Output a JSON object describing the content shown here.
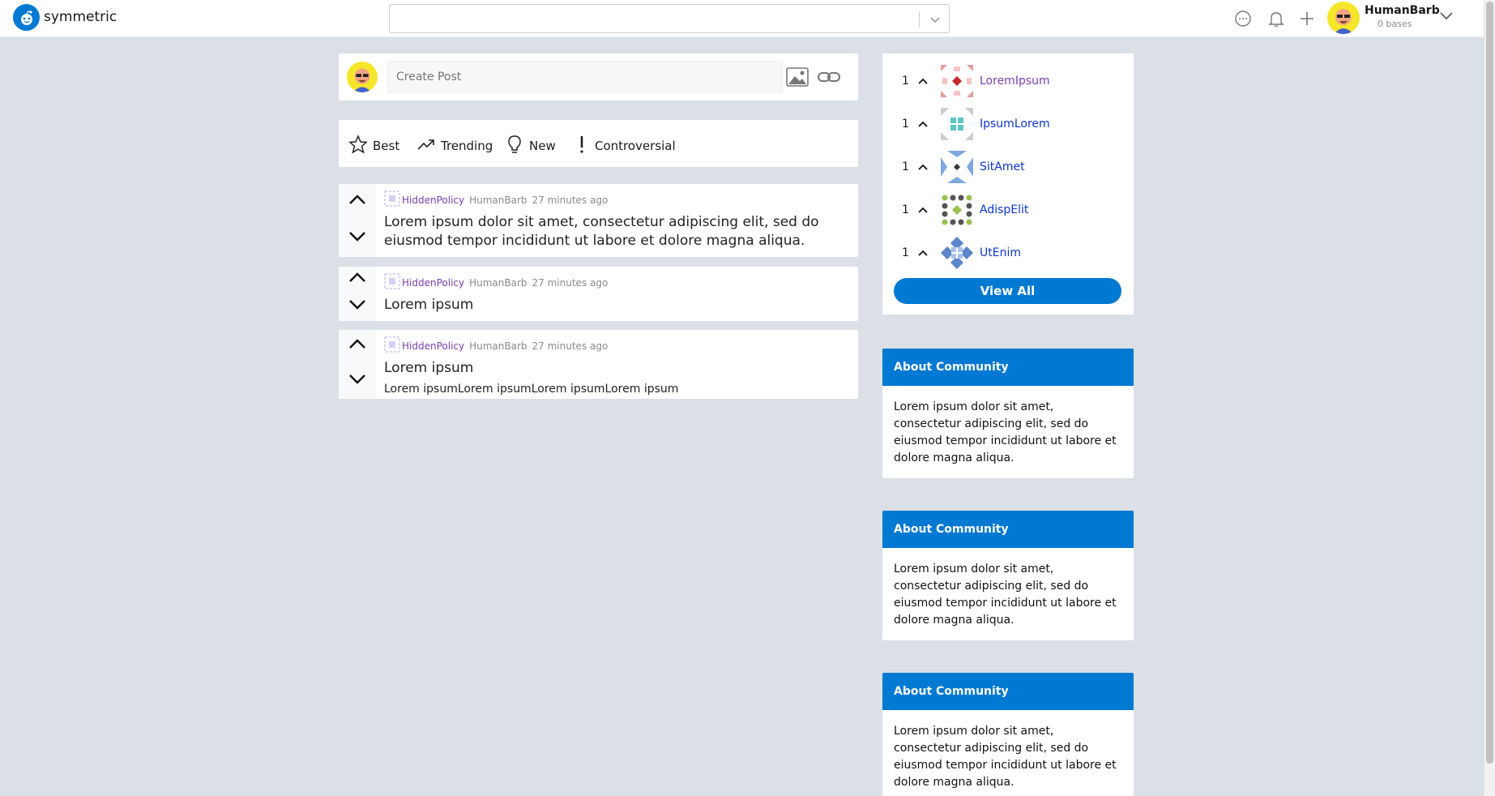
{
  "header": {
    "brand": "symmetric",
    "search_value": "",
    "user_name": "HumanBarb",
    "user_sub": "0 bases"
  },
  "create_post": {
    "placeholder": "Create Post"
  },
  "sort": {
    "items": [
      {
        "label": "Best",
        "icon": "star-icon"
      },
      {
        "label": "Trending",
        "icon": "trending-icon"
      },
      {
        "label": "New",
        "icon": "lightbulb-icon"
      },
      {
        "label": "Controversial",
        "icon": "exclamation-icon"
      }
    ]
  },
  "posts": [
    {
      "community": "HiddenPolicy",
      "author": "HumanBarb",
      "time": "27 minutes ago",
      "title": "Lorem ipsum dolor sit amet, consectetur adipiscing elit, sed do eiusmod tempor incididunt ut labore et dolore magna aliqua.",
      "text": ""
    },
    {
      "community": "HiddenPolicy",
      "author": "HumanBarb",
      "time": "27 minutes ago",
      "title": "Lorem ipsum",
      "text": ""
    },
    {
      "community": "HiddenPolicy",
      "author": "HumanBarb",
      "time": "27 minutes ago",
      "title": "Lorem ipsum",
      "text": "Lorem ipsumLorem ipsumLorem ipsumLorem ipsum"
    }
  ],
  "communities": {
    "items": [
      {
        "rank": "1",
        "name": "LoremIpsum",
        "color": "#7b3fb5"
      },
      {
        "rank": "1",
        "name": "IpsumLorem",
        "color": "#0d35d8"
      },
      {
        "rank": "1",
        "name": "SitAmet",
        "color": "#0d35d8"
      },
      {
        "rank": "1",
        "name": "AdispElit",
        "color": "#0d35d8"
      },
      {
        "rank": "1",
        "name": "UtEnim",
        "color": "#0d35d8"
      }
    ],
    "view_all": "View All"
  },
  "about": [
    {
      "title": "About Community",
      "text": "Lorem ipsum dolor sit amet, consectetur adipiscing elit, sed do eiusmod tempor incididunt ut labore et dolore magna aliqua."
    },
    {
      "title": "About Community",
      "text": "Lorem ipsum dolor sit amet, consectetur adipiscing elit, sed do eiusmod tempor incididunt ut labore et dolore magna aliqua."
    },
    {
      "title": "About Community",
      "text": "Lorem ipsum dolor sit amet, consectetur adipiscing elit, sed do eiusmod tempor incididunt ut labore et dolore magna aliqua."
    }
  ],
  "colors": {
    "accent": "#0079d3",
    "background": "#dae0e6",
    "community_link": "#7b3fb5"
  }
}
